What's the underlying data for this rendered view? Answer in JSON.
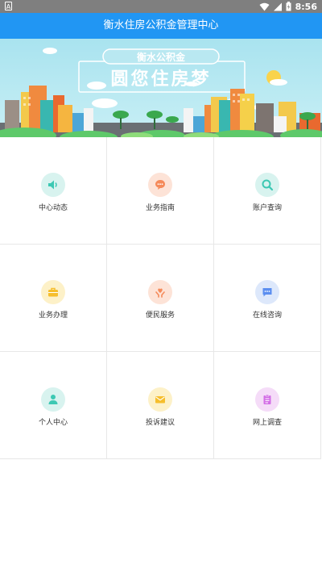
{
  "statusbar": {
    "left_icon": "a-badge-icon",
    "time": "8:56"
  },
  "header": {
    "title": "衡水住房公积金管理中心"
  },
  "banner": {
    "subtitle": "衡水公积金",
    "title": "圆您住房梦"
  },
  "menu": [
    {
      "label": "中心动态",
      "icon": "speaker-icon",
      "bg": "#d8f3ef",
      "fg": "#3cc8b3"
    },
    {
      "label": "业务指南",
      "icon": "chat-bubble-icon",
      "bg": "#fde3d7",
      "fg": "#f58a5a"
    },
    {
      "label": "账户查询",
      "icon": "search-icon",
      "bg": "#d8f3ef",
      "fg": "#3cc8b3"
    },
    {
      "label": "业务办理",
      "icon": "briefcase-icon",
      "bg": "#fdf1c8",
      "fg": "#f6be2c"
    },
    {
      "label": "便民服务",
      "icon": "hands-heart-icon",
      "bg": "#fde3d7",
      "fg": "#f58a5a"
    },
    {
      "label": "在线咨询",
      "icon": "message-icon",
      "bg": "#dde8fb",
      "fg": "#5b8ef0"
    },
    {
      "label": "个人中心",
      "icon": "person-icon",
      "bg": "#d8f3ef",
      "fg": "#3cc8b3"
    },
    {
      "label": "投诉建议",
      "icon": "envelope-icon",
      "bg": "#fdf1c8",
      "fg": "#f6be2c"
    },
    {
      "label": "网上调查",
      "icon": "clipboard-icon",
      "bg": "#f5dcf8",
      "fg": "#d36ee6"
    }
  ]
}
